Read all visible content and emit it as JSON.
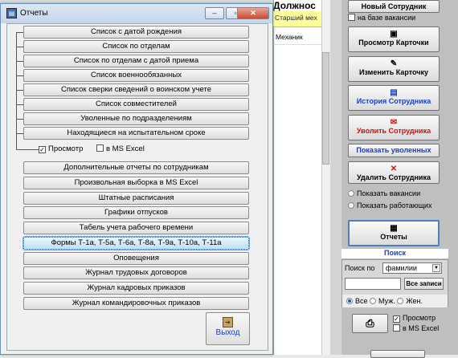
{
  "background": {
    "table_title": "Должнос",
    "table_header": "Старший мех",
    "table_cell": "Механик"
  },
  "right_panel": {
    "btn_new": "Новый Сотрудник",
    "chk_vacancy": "на базе вакансии",
    "btn_view": "Просмотр Карточки",
    "btn_edit": "Изменить Карточку",
    "btn_history": "История Сотрудника",
    "btn_fire": "Уволить Сотрудника",
    "btn_show_fired": "Показать уволенных",
    "btn_delete": "Удалить Сотрудника",
    "radio_vacancies": "Показать вакансии",
    "radio_working": "Показать работающих",
    "btn_reports": "Отчеты",
    "search_title": "Поиск",
    "search_by_label": "Поиск по",
    "search_by_value": "фамилии",
    "btn_all_records": "Все записи",
    "radio_all": "Все",
    "radio_male": "Муж.",
    "radio_female": "Жен.",
    "chk_preview": "Просмотр",
    "chk_msexcel": "в MS Excel"
  },
  "dialog": {
    "title": "Отчеты",
    "tree_buttons": [
      "Список с датой рождения",
      "Список по отделам",
      "Список по отделам с датой приема",
      "Список военнообязанных",
      "Список сверки сведений о воинском учете",
      "Список совместителей",
      "Уволенные по подразделениям",
      "Находящиеся на испытательном сроке"
    ],
    "chk_preview": "Просмотр",
    "chk_msexcel": "в MS Excel",
    "buttons": [
      "Дополнительные отчеты по сотрудникам",
      "Произвольная выборка в MS Excel",
      "Штатные расписания",
      "Графики отпусков",
      "Табель учета рабочего времени",
      "Формы Т-1а, Т-5а, Т-6а, Т-8а, Т-9а, Т-10а, Т-11а",
      "Оповещения",
      "Журнал трудовых договоров",
      "Журнал кадровых приказов",
      "Журнал командировочных приказов"
    ],
    "exit_label": "Выход"
  }
}
